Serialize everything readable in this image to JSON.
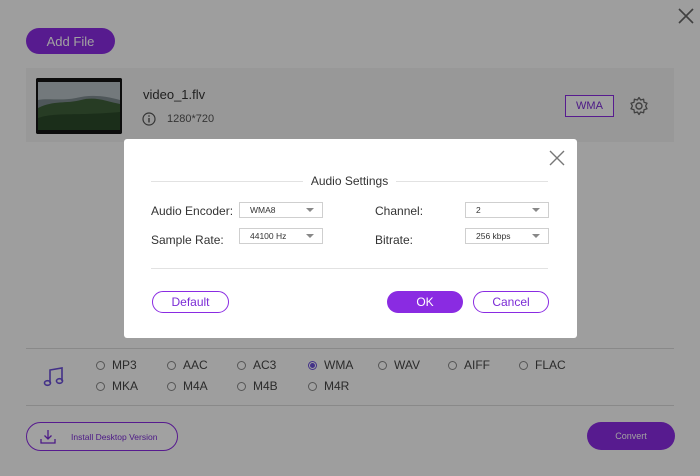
{
  "toolbar": {
    "add_file_label": "Add File"
  },
  "file": {
    "name": "video_1.flv",
    "resolution": "1280*720",
    "output_format": "WMA"
  },
  "format_panel": {
    "options": [
      "MP3",
      "AAC",
      "AC3",
      "WMA",
      "WAV",
      "AIFF",
      "FLAC",
      "MKA",
      "M4A",
      "M4B",
      "M4R"
    ],
    "selected": "WMA"
  },
  "footer": {
    "install_label": "Install Desktop Version",
    "convert_label": "Convert"
  },
  "modal": {
    "title": "Audio Settings",
    "audio_encoder": {
      "label": "Audio Encoder:",
      "value": "WMA8"
    },
    "sample_rate": {
      "label": "Sample Rate:",
      "value": "44100 Hz"
    },
    "channel": {
      "label": "Channel:",
      "value": "2"
    },
    "bitrate": {
      "label": "Bitrate:",
      "value": "256 kbps"
    },
    "default_label": "Default",
    "ok_label": "OK",
    "cancel_label": "Cancel"
  },
  "colors": {
    "accent": "#8a2be2",
    "radio_checked": "#6a4fd8"
  },
  "icons": [
    "close-icon",
    "info-icon",
    "gear-icon",
    "music-note-icon",
    "download-icon",
    "dropdown-caret-icon"
  ]
}
